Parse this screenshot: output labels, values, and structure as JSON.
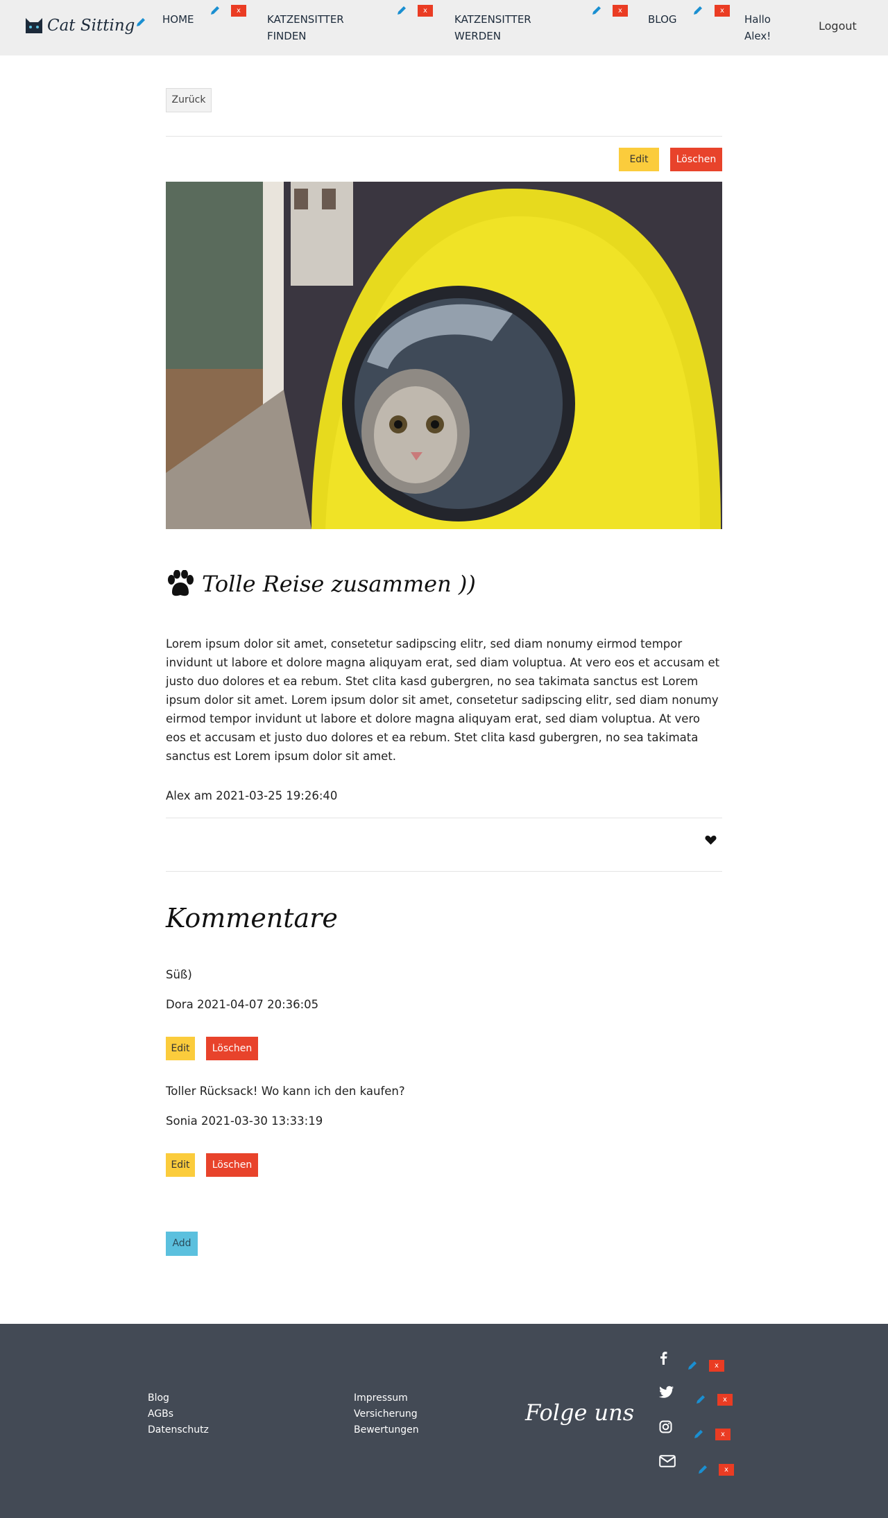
{
  "nav": {
    "logo_text": "Cat Sitting",
    "items": [
      {
        "label": "HOME"
      },
      {
        "label": "KATZENSITTER FINDEN"
      },
      {
        "label": "KATZENSITTER WERDEN"
      },
      {
        "label": "BLOG"
      }
    ],
    "delete_glyph": "x",
    "greeting": "Hallo Alex!",
    "logout": "Logout"
  },
  "main": {
    "back_label": "Zurück",
    "edit_label": "Edit",
    "delete_label": "Löschen",
    "post": {
      "title": "Tolle Reise zusammen ))",
      "body": "Lorem ipsum dolor sit amet, consetetur sadipscing elitr, sed diam nonumy eirmod tempor invidunt ut labore et dolore magna aliquyam erat, sed diam voluptua. At vero eos et accusam et justo duo dolores et ea rebum. Stet clita kasd gubergren, no sea takimata sanctus est Lorem ipsum dolor sit amet. Lorem ipsum dolor sit amet, consetetur sadipscing elitr, sed diam nonumy eirmod tempor invidunt ut labore et dolore magna aliquyam erat, sed diam voluptua. At vero eos et accusam et justo duo dolores et ea rebum. Stet clita kasd gubergren, no sea takimata sanctus est Lorem ipsum dolor sit amet.",
      "meta": "Alex am 2021-03-25 19:26:40",
      "image_icon": "cat-in-yellow-backpack-photo",
      "like_icon": "heart-icon"
    },
    "comments_title": "Kommentare",
    "comments": [
      {
        "text": "Süß)",
        "meta": "Dora 2021-04-07 20:36:05"
      },
      {
        "text": "Toller Rücksack! Wo kann ich den kaufen?",
        "meta": "Sonia 2021-03-30 13:33:19"
      }
    ],
    "add_label": "Add"
  },
  "footer": {
    "col1": [
      "Blog",
      "AGBs",
      "Datenschutz"
    ],
    "col2": [
      "Impressum",
      "Versicherung",
      "Bewertungen"
    ],
    "follow": "Folge uns",
    "social_icons": [
      "facebook-icon",
      "twitter-icon",
      "instagram-icon",
      "mail-icon"
    ]
  },
  "colors": {
    "nav_bg": "#eeeeee",
    "edit": "#fbcc3c",
    "delete": "#e8432b",
    "add": "#5bc0de",
    "footer_bg": "#434a55",
    "pencil": "#1a8fd1"
  }
}
